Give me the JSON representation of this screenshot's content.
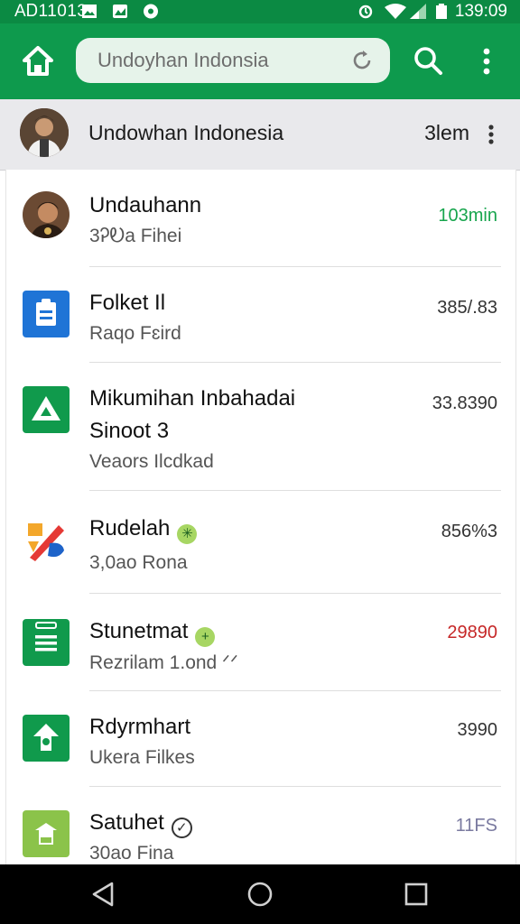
{
  "status_bar": {
    "time_left": "AᎠ11013",
    "time_right": "139:09",
    "icons": [
      "image-icon",
      "photo-icon",
      "record-icon",
      "alarm-icon",
      "wifi-icon",
      "signal-icon",
      "battery-icon"
    ]
  },
  "app_bar": {
    "search_placeholder": "Undoyhan Indonsia",
    "icons": [
      "home-icon",
      "refresh-icon",
      "search-icon",
      "more-vert-icon"
    ]
  },
  "header": {
    "title": "Undowhan Indonesia",
    "count": "3lem"
  },
  "items": [
    {
      "title": "Undauhann",
      "subtitle": "3ᎮᎧa Fihei",
      "value": "103min",
      "value_color": "#17a54d",
      "icon": "avatar-icon"
    },
    {
      "title": "Folket Il",
      "subtitle": "Raqo Fɛird",
      "value": "385/.83",
      "value_color": "#333333",
      "icon": "clipboard-icon"
    },
    {
      "title": "Mikumihan Inbahadai",
      "title2": "Sinoot 3",
      "subtitle": "Veaors Ilcdkad",
      "value": "33.8390",
      "value_color": "#333333",
      "icon": "drive-icon"
    },
    {
      "title": "Rudelah",
      "subtitle": "3,0ao Rona",
      "value": "856%3",
      "value_color": "#333333",
      "icon": "photos-icon",
      "badge": "star"
    },
    {
      "title": "Stunetmat",
      "subtitle": "Rezrilam 1.ond ᐟᐟ",
      "value": "29890",
      "value_color": "#c62828",
      "icon": "list-icon",
      "badge": "plus"
    },
    {
      "title": "Rdyrmhart",
      "subtitle": "Ukera Filkes",
      "value": "3990",
      "value_color": "#333333",
      "icon": "arrow-icon"
    },
    {
      "title": "Satuhet",
      "subtitle": "30ao Fina",
      "value": "11FS",
      "value_color": "#7a7aa0",
      "icon": "android-icon",
      "badge": "check"
    }
  ],
  "colors": {
    "primary": "#0e9a4d",
    "status": "#0b8a43",
    "header_bg": "#e9e9ec",
    "value_green": "#17a54d",
    "value_red": "#c62828"
  },
  "nav_bar": {
    "icons": [
      "back-icon",
      "home-circle-icon",
      "recents-icon"
    ]
  }
}
